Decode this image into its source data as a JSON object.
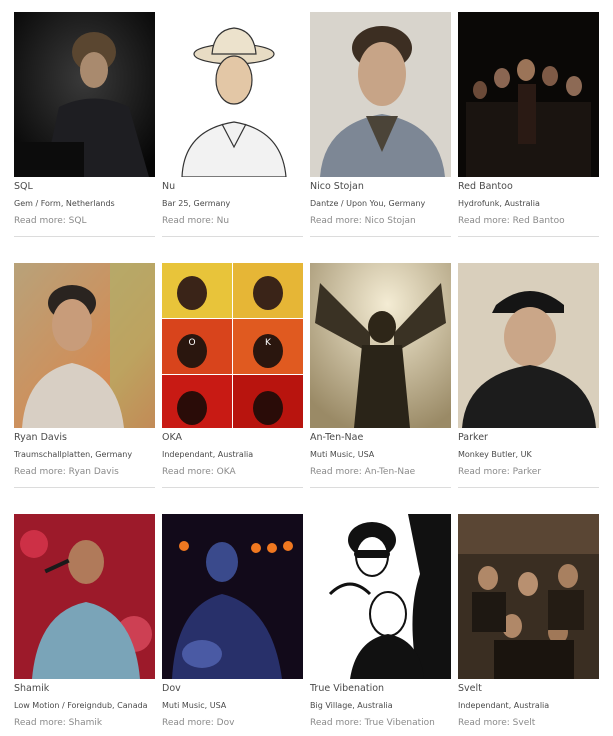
{
  "artists": [
    {
      "name": "SQL",
      "meta": "Gem / Form, Netherlands",
      "more": "Read more: SQL"
    },
    {
      "name": "Nu",
      "meta": "Bar 25, Germany",
      "more": "Read more: Nu"
    },
    {
      "name": "Nico Stojan",
      "meta": "Dantze / Upon You, Germany",
      "more": "Read more: Nico Stojan"
    },
    {
      "name": "Red Bantoo",
      "meta": "Hydrofunk, Australia",
      "more": "Read more: Red Bantoo"
    },
    {
      "name": "Ryan Davis",
      "meta": "Traumschallplatten, Germany",
      "more": "Read more: Ryan Davis"
    },
    {
      "name": "OKA",
      "meta": "Independant, Australia",
      "more": "Read more: OKA"
    },
    {
      "name": "An-Ten-Nae",
      "meta": "Muti Music, USA",
      "more": "Read more: An-Ten-Nae"
    },
    {
      "name": "Parker",
      "meta": "Monkey Butler, UK",
      "more": "Read more: Parker"
    },
    {
      "name": "Shamik",
      "meta": "Low Motion / Foreigndub, Canada",
      "more": "Read more: Shamik"
    },
    {
      "name": "Dov",
      "meta": "Muti Music, USA",
      "more": "Read more: Dov"
    },
    {
      "name": "True Vibenation",
      "meta": "Big Village, Australia",
      "more": "Read more: True Vibenation"
    },
    {
      "name": "Svelt",
      "meta": "Independant, Australia",
      "more": "Read more: Svelt"
    }
  ],
  "oka_tiles": [
    "O",
    "K"
  ]
}
